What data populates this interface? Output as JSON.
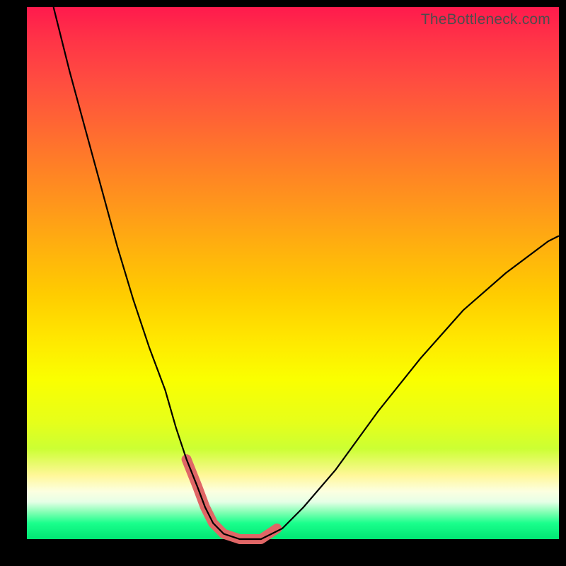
{
  "chart_data": {
    "type": "line",
    "title": "",
    "xlabel": "",
    "ylabel": "",
    "xlim": [
      0,
      100
    ],
    "ylim": [
      0,
      100
    ],
    "watermark": "TheBottleneck.com",
    "series": [
      {
        "name": "curve",
        "x": [
          5,
          8,
          11,
          14,
          17,
          20,
          23,
          26,
          28,
          30,
          32,
          33.5,
          35,
          37,
          40,
          44,
          48,
          52,
          58,
          66,
          74,
          82,
          90,
          98,
          100
        ],
        "y": [
          100,
          88,
          77,
          66,
          55,
          45,
          36,
          28,
          21,
          15,
          10,
          6,
          3,
          1,
          0,
          0,
          2,
          6,
          13,
          24,
          34,
          43,
          50,
          56,
          57
        ]
      },
      {
        "name": "highlight-segment",
        "x": [
          30,
          32,
          33.5,
          35,
          37,
          40,
          44,
          47
        ],
        "y": [
          15,
          10,
          6,
          3,
          1,
          0,
          0,
          2
        ]
      }
    ],
    "grid": false,
    "legend": false,
    "background": "rainbow-vertical"
  },
  "colors": {
    "curve": "#000000",
    "highlight": "#e06666",
    "frame": "#000000"
  }
}
